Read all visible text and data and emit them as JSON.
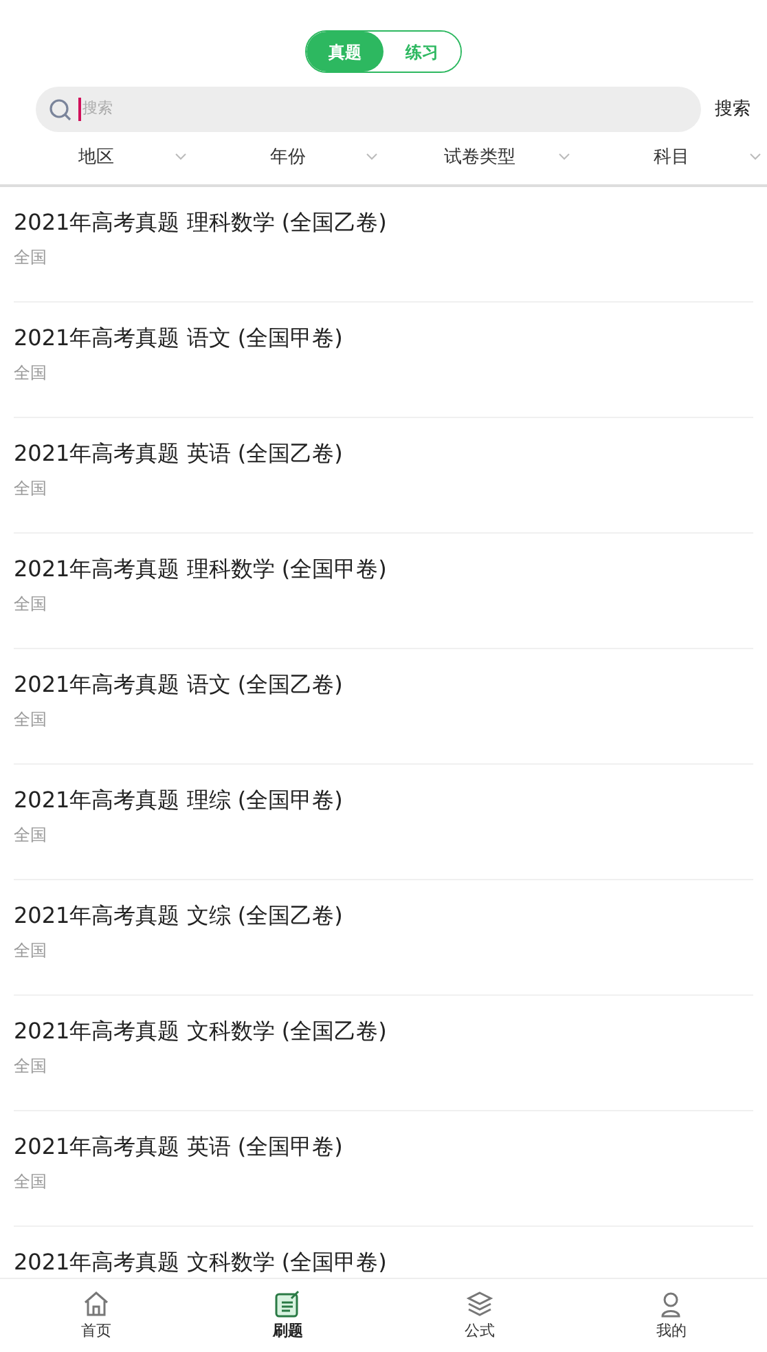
{
  "segments": [
    {
      "label": "真题",
      "selected": true
    },
    {
      "label": "练习",
      "selected": false
    }
  ],
  "search": {
    "placeholder": "搜索",
    "button": "搜索"
  },
  "filters": [
    "地区",
    "年份",
    "试卷类型",
    "科目"
  ],
  "papers": [
    {
      "title": "2021年高考真题 理科数学 (全国乙卷)",
      "region": "全国"
    },
    {
      "title": "2021年高考真题 语文 (全国甲卷)",
      "region": "全国"
    },
    {
      "title": "2021年高考真题 英语 (全国乙卷)",
      "region": "全国"
    },
    {
      "title": "2021年高考真题 理科数学 (全国甲卷)",
      "region": "全国"
    },
    {
      "title": "2021年高考真题 语文 (全国乙卷)",
      "region": "全国"
    },
    {
      "title": "2021年高考真题 理综 (全国甲卷)",
      "region": "全国"
    },
    {
      "title": "2021年高考真题 文综 (全国乙卷)",
      "region": "全国"
    },
    {
      "title": "2021年高考真题 文科数学 (全国乙卷)",
      "region": "全国"
    },
    {
      "title": "2021年高考真题 英语 (全国甲卷)",
      "region": "全国"
    },
    {
      "title": "2021年高考真题 文科数学 (全国甲卷)"
    }
  ],
  "nav": [
    {
      "label": "首页",
      "selected": false,
      "kind": "home"
    },
    {
      "label": "刷题",
      "selected": true,
      "kind": "practice"
    },
    {
      "label": "公式",
      "selected": false,
      "kind": "formula"
    },
    {
      "label": "我的",
      "selected": false,
      "kind": "profile"
    }
  ]
}
